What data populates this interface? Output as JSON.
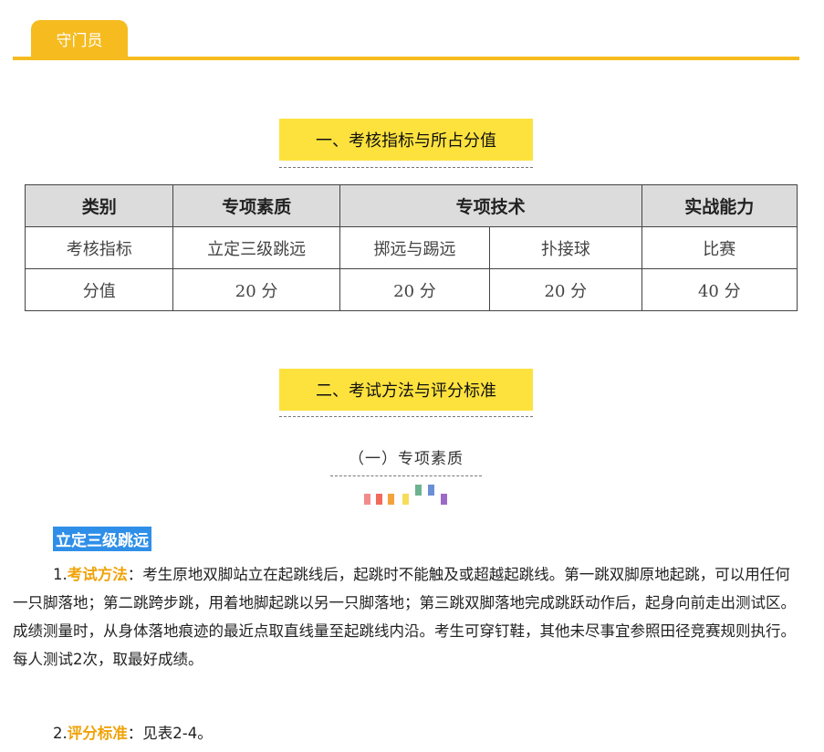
{
  "tab": {
    "label": "守门员"
  },
  "section1": {
    "title": "一、考核指标与所占分值"
  },
  "table": {
    "headers": [
      "类别",
      "专项素质",
      "专项技术",
      "实战能力"
    ],
    "row_indicator": [
      "考核指标",
      "立定三级跳远",
      "掷远与踢远",
      "扑接球",
      "比赛"
    ],
    "row_score": [
      "分值",
      "20 分",
      "20 分",
      "20 分",
      "40 分"
    ]
  },
  "section2": {
    "title": "二、考试方法与评分标准"
  },
  "subsection": {
    "title": "（一）专项素质"
  },
  "deco_colors": [
    "#f28b8b",
    "#f26a5c",
    "#f6a23c",
    "#f6dd5a",
    "#6db38f",
    "#6b8fd6",
    "#9b6bc7"
  ],
  "topic": {
    "label": "立定三级跳远"
  },
  "method": {
    "num": "1.",
    "label": "考试方法",
    "colon": "：",
    "text": "考生原地双脚站立在起跳线后，起跳时不能触及或超越起跳线。第一跳双脚原地起跳，可以用任何一只脚落地；第二跳跨步跳，用着地脚起跳以另一只脚落地；第三跳双脚落地完成跳跃动作后，起身向前走出测试区。成绩测量时，从身体落地痕迹的最近点取直线量至起跳线内沿。考生可穿钉鞋，其他未尽事宜参照田径竞赛规则执行。每人测试2次，取最好成绩。"
  },
  "scoring": {
    "num": "2.",
    "label": "评分标准",
    "colon": "：",
    "text": "见表2-4。"
  }
}
